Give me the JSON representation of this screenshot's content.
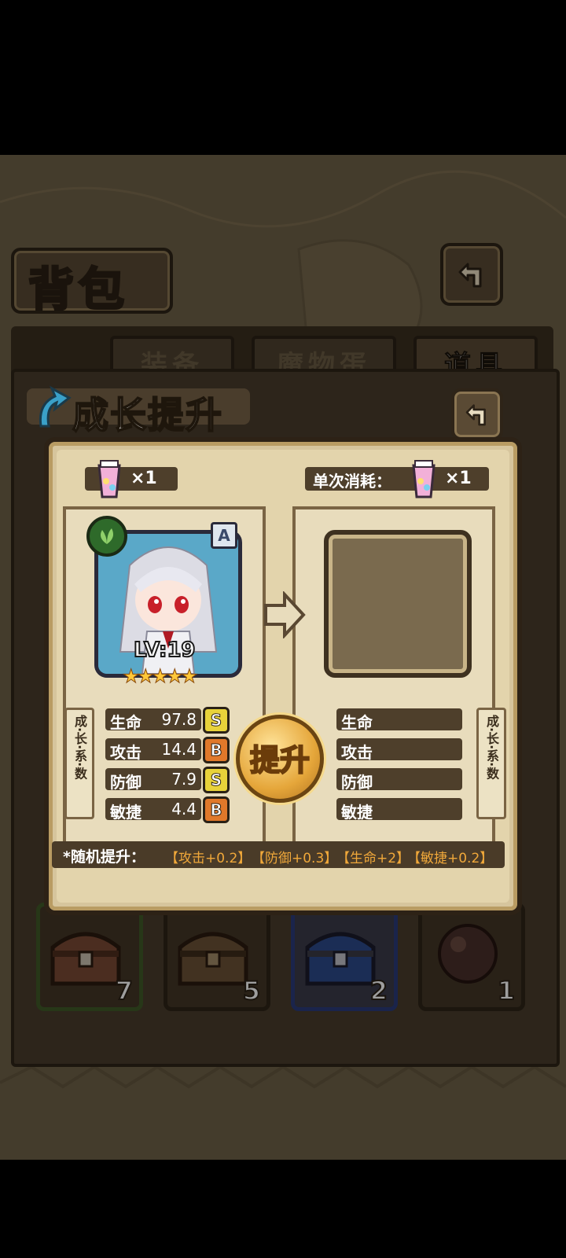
{
  "header": {
    "title": "背包"
  },
  "tabs": [
    {
      "label": "装备",
      "active": false
    },
    {
      "label": "魔物蛋",
      "active": false
    },
    {
      "label": "道具",
      "active": true
    }
  ],
  "inventory": [
    {
      "name": "treasure-chest-brown",
      "count": "7",
      "frame_color": "#3f5a28"
    },
    {
      "name": "treasure-chest-wood",
      "count": "5",
      "frame_color": "#2e2418"
    },
    {
      "name": "treasure-chest-blue",
      "count": "2",
      "frame_color": "#2a3a7a"
    },
    {
      "name": "dark-orb",
      "count": "1",
      "frame_color": "#2e2418"
    }
  ],
  "dialog": {
    "title": "成长提升",
    "owned_count": "×1",
    "cost_label": "单次消耗：",
    "cost_count": "×1",
    "character": {
      "level": "LV:19",
      "rank": "A",
      "stars": 5,
      "element": "leaf-icon"
    },
    "growth_tag": "成·长·系·数",
    "stats_before": [
      {
        "label": "生命",
        "value": "97.8",
        "grade": "S"
      },
      {
        "label": "攻击",
        "value": "14.4",
        "grade": "B"
      },
      {
        "label": "防御",
        "value": "7.9",
        "grade": "S"
      },
      {
        "label": "敏捷",
        "value": "4.4",
        "grade": "B"
      }
    ],
    "stats_after": [
      {
        "label": "生命"
      },
      {
        "label": "攻击"
      },
      {
        "label": "防御"
      },
      {
        "label": "敏捷"
      }
    ],
    "upgrade_button": "提升",
    "bonus_label": "*随机提升：",
    "bonus_items": [
      "【攻击+0.2】",
      "【防御+0.3】",
      "【生命+2】",
      "【敏捷+0.2】"
    ]
  },
  "colors": {
    "grade_S": "#e8d23a",
    "grade_B": "#e0782a",
    "accent_orange": "#f0a83a"
  }
}
